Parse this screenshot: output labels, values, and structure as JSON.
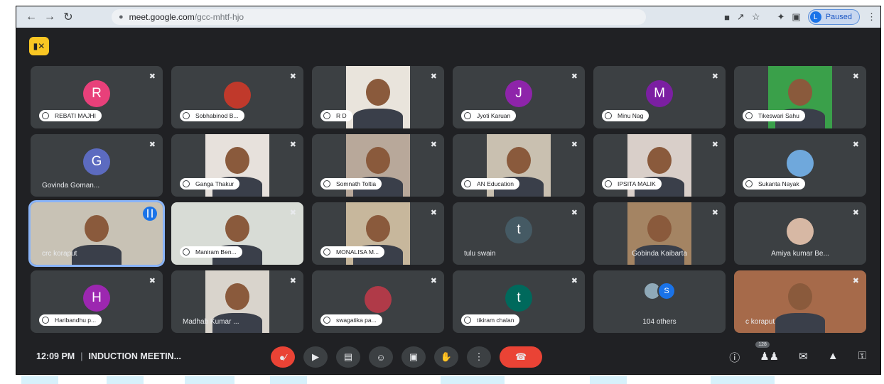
{
  "browser": {
    "url_domain": "meet.google.com",
    "url_path": "/gcc-mhtf-hjo",
    "profile_initial": "L",
    "profile_status": "Paused"
  },
  "participants": [
    {
      "name": "REBATI MAJHI",
      "type": "avatar",
      "initial": "R",
      "color": "#e8407a",
      "label_style": "pill"
    },
    {
      "name": "Sobhabinod B...",
      "type": "photo-avatar",
      "color": "#c0392b",
      "label_style": "pill"
    },
    {
      "name": "R D",
      "type": "video",
      "color": "#e9e4dc",
      "label_style": "pill"
    },
    {
      "name": "Jyoti Karuan",
      "type": "avatar",
      "initial": "J",
      "color": "#8e24aa",
      "label_style": "pill"
    },
    {
      "name": "Minu Nag",
      "type": "avatar",
      "initial": "M",
      "color": "#7b1fa2",
      "label_style": "pill"
    },
    {
      "name": "Tikeswari Sahu",
      "type": "video",
      "color": "#3aa04a",
      "label_style": "pill"
    },
    {
      "name": "Govinda Goman...",
      "type": "avatar",
      "initial": "G",
      "color": "#5c6bc0",
      "label_style": "text"
    },
    {
      "name": "Ganga Thakur",
      "type": "video",
      "color": "#e7e1dc",
      "label_style": "pill"
    },
    {
      "name": "Somnath Toltia",
      "type": "video",
      "color": "#b8a89a",
      "label_style": "pill"
    },
    {
      "name": "AN Education",
      "type": "video",
      "color": "#c9c0b0",
      "label_style": "pill"
    },
    {
      "name": "IPSITA MALIK",
      "type": "video",
      "color": "#d9cfc9",
      "label_style": "pill"
    },
    {
      "name": "Sukanta Nayak",
      "type": "photo-avatar",
      "color": "#6fa8dc",
      "label_style": "pill"
    },
    {
      "name": "crc koraput",
      "type": "video",
      "color": "#c8c2b5",
      "label_style": "text",
      "speaking": true
    },
    {
      "name": "Maniram Ben...",
      "type": "video",
      "color": "#d8dcd6",
      "label_style": "pill"
    },
    {
      "name": "MONALISA M...",
      "type": "video",
      "color": "#c7b79c",
      "label_style": "pill"
    },
    {
      "name": "tulu swain",
      "type": "avatar",
      "initial": "t",
      "color": "#455a64",
      "label_style": "text"
    },
    {
      "name": "Gobinda Kaibarta",
      "type": "video",
      "color": "#a48463",
      "label_style": "text-center"
    },
    {
      "name": "Amiya kumar Be...",
      "type": "photo-avatar",
      "color": "#d7b8a4",
      "label_style": "text-center"
    },
    {
      "name": "Haribandhu p...",
      "type": "avatar",
      "initial": "H",
      "color": "#9c27b0",
      "label_style": "pill"
    },
    {
      "name": "Madhab Kumar ...",
      "type": "video",
      "color": "#d9d4cc",
      "label_style": "text"
    },
    {
      "name": "swagatika pa...",
      "type": "photo-avatar",
      "color": "#b03a48",
      "label_style": "pill"
    },
    {
      "name": "tikiram chalan",
      "type": "avatar",
      "initial": "t",
      "color": "#00695c",
      "label_style": "pill"
    },
    {
      "name": "104 others",
      "type": "others",
      "initial": "S",
      "color": "#1a73e8",
      "label_style": "text-center"
    },
    {
      "name": "c koraput",
      "type": "video",
      "color": "#a66a4a",
      "label_style": "text"
    }
  ],
  "bottom_bar": {
    "time": "12:09 PM",
    "separator": "|",
    "meeting_title": "INDUCTION MEETIN...",
    "participant_count": "128"
  },
  "colors": {
    "meet_bg": "#202124",
    "tile_bg": "#3c4043",
    "end_call": "#ea4335",
    "camera_off_badge": "#f9c623"
  }
}
